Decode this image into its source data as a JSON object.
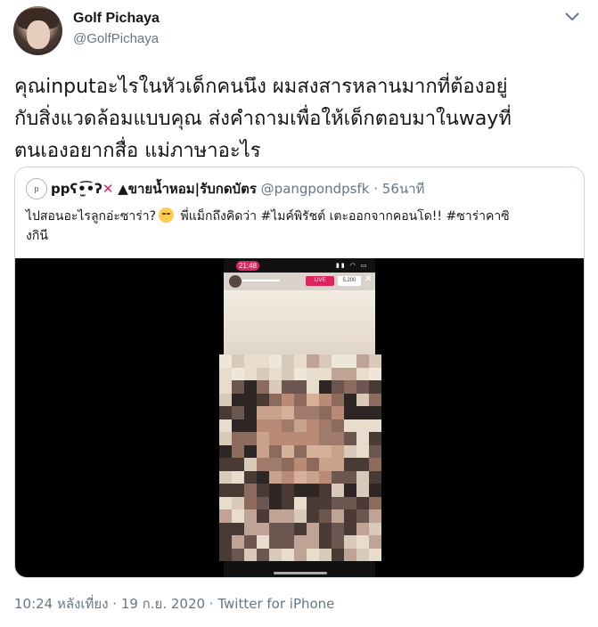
{
  "author": {
    "name": "Golf Pichaya",
    "handle": "@GolfPichaya"
  },
  "tweet": {
    "lines": [
      "คุณinputอะไรในหัวเด็กคนนึง ผมสงสารหลานมากที่ต้องอยู่",
      "กับสิ่งแวดล้อมแบบคุณ ส่งคำถามเพื่อให้เด็กตอบมาในwayที่",
      "ตนเองอยากสื่อ แม่ภาษาอะไร"
    ]
  },
  "quoted": {
    "avatar_text": "p",
    "name": "ppʕ•̫͡•ʔ",
    "name_suffix": "ขายน้ำหอม|รับกดบัตร",
    "handle": "@pangpondpsfk",
    "time": "· 56นาที",
    "text_line1_a": "ไปสอนอะไรลูกอ่ะซาร่า?",
    "text_line1_b": " พี่แม็กถึงคิดว่า #ไมค์พิรัชต์ เตะออกจากคอนโด!! #ซาร่าคาซิ",
    "text_line2": "งกินี",
    "media": {
      "status_time": "21:48",
      "live_label": "LIVE",
      "viewers": "5,200"
    }
  },
  "footer": {
    "text": "10:24 หลังเที่ยง · 19 ก.ย. 2020 · Twitter for iPhone"
  }
}
